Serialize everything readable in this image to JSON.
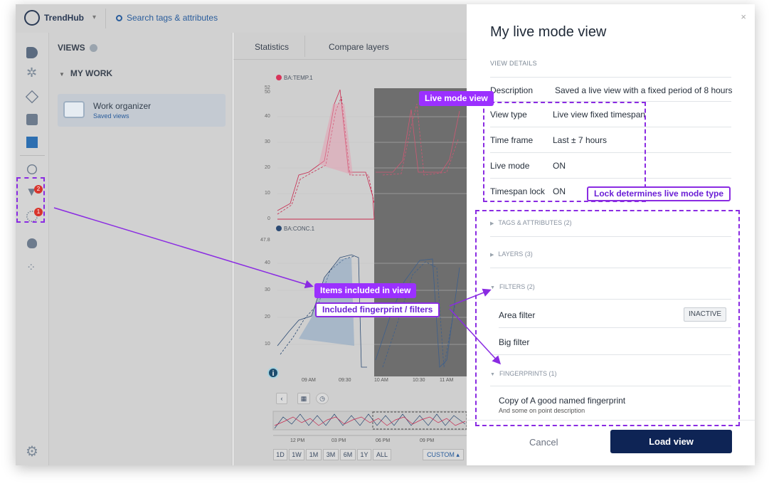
{
  "app": {
    "name": "TrendHub",
    "search_placeholder": "Search tags & attributes"
  },
  "rail": {
    "filter_badge": "2",
    "fingerprint_badge": "1"
  },
  "views": {
    "header": "VIEWS",
    "section": "MY WORK",
    "organizer_title": "Work organizer",
    "organizer_subtitle": "Saved views"
  },
  "chart": {
    "tabs": [
      "Statistics",
      "Compare layers"
    ],
    "tag1": "BA:TEMP.1",
    "tag1_color": "#d8345a",
    "tag2": "BA:CONC.1",
    "tag2_color": "#2b4a73",
    "y1_ticks": [
      "52",
      "50",
      "40",
      "30",
      "20",
      "10",
      "0"
    ],
    "y2_ticks": [
      "47.8",
      "40",
      "30",
      "20",
      "10"
    ],
    "x_ticks": [
      "09 AM",
      "09:30",
      "10 AM",
      "10:30",
      "11 AM"
    ],
    "overview_ticks": [
      "12 PM",
      "03 PM",
      "06 PM",
      "09 PM"
    ],
    "ranges": [
      "1D",
      "1W",
      "1M",
      "3M",
      "6M",
      "1Y",
      "ALL"
    ],
    "custom": "CUSTOM"
  },
  "panel": {
    "title": "My live mode view",
    "section": "VIEW DETAILS",
    "rows": [
      {
        "key": "Description",
        "value": "Saved a live view with a fixed period of 8 hours"
      },
      {
        "key": "View type",
        "value": "Live view fixed timespan"
      },
      {
        "key": "Time frame",
        "value": "Last ± 7 hours"
      },
      {
        "key": "Live mode",
        "value": "ON"
      },
      {
        "key": "Timespan lock",
        "value": "ON"
      }
    ],
    "tags_attributes": "TAGS & ATTRIBUTES (2)",
    "layers": "LAYERS (3)",
    "filters": "FILTERS (2)",
    "filter_items": [
      "Area filter",
      "Big filter"
    ],
    "inactive": "INACTIVE",
    "fingerprints": "FINGERPRINTS (1)",
    "fingerprint_name": "Copy of A good named fingerprint",
    "fingerprint_desc": "And some on point description",
    "cancel": "Cancel",
    "load": "Load view"
  },
  "annotations": {
    "live_mode_view": "Live mode view",
    "lock_type": "Lock determines live mode type",
    "items_included": "Items included in view",
    "fingerprint_filters": "Included fingerprint / filters"
  },
  "colors": {
    "accent": "#8a2be2",
    "primary_button": "#0e2455"
  }
}
